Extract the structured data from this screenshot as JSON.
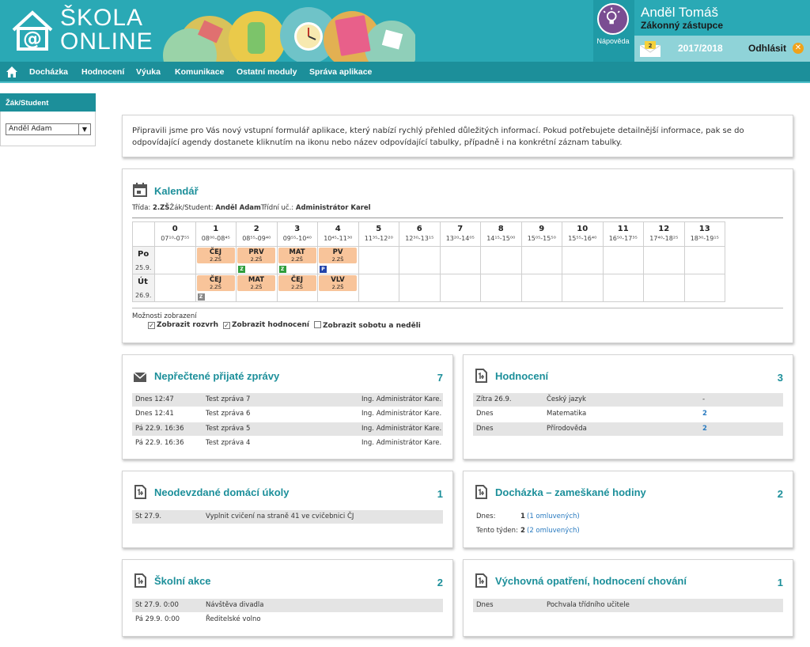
{
  "app": {
    "logo_line1": "ŠKOLA",
    "logo_line2": "ONLINE"
  },
  "user": {
    "help_label": "Nápověda",
    "name": "Anděl Tomáš",
    "role": "Zákonný zástupce",
    "messages_badge": "2",
    "school_year": "2017/2018",
    "logout_label": "Odhlásit"
  },
  "nav": {
    "items": [
      "Docházka",
      "Hodnocení",
      "Výuka",
      "Komunikace",
      "Ostatní moduly",
      "Správa aplikace"
    ]
  },
  "sidebar": {
    "header": "Žák/Student",
    "selected_student": "Anděl Adam"
  },
  "intro": {
    "text": "Připravili jsme pro Vás nový vstupní formulář aplikace, který nabízí rychlý přehled důležitých informací. Pokud potřebujete detailnější informace, pak se do odpovídající agendy dostanete kliknutím na ikonu nebo název odpovídající tabulky, případně i na konkrétní záznam tabulky."
  },
  "calendar": {
    "title": "Kalendář",
    "meta_class_label": "Třída: ",
    "meta_class": "2.ZŠ",
    "meta_student_label": "Žák/Student: ",
    "meta_student": "Anděl Adam",
    "meta_teacher_label": "Třídní uč.: ",
    "meta_teacher": "Administrátor Karel",
    "hours": [
      {
        "n": "0",
        "t": "07¹⁰-07⁵⁵"
      },
      {
        "n": "1",
        "t": "08⁰⁰-08⁴⁵"
      },
      {
        "n": "2",
        "t": "08⁵⁵-09⁴⁰"
      },
      {
        "n": "3",
        "t": "09⁵⁵-10⁴⁰"
      },
      {
        "n": "4",
        "t": "10⁴⁵-11³⁰"
      },
      {
        "n": "5",
        "t": "11³⁵-12²⁰"
      },
      {
        "n": "6",
        "t": "12³⁰-13¹⁵"
      },
      {
        "n": "7",
        "t": "13²⁰-14⁰⁵"
      },
      {
        "n": "8",
        "t": "14¹⁵-15⁰⁰"
      },
      {
        "n": "9",
        "t": "15⁰⁵-15⁵⁰"
      },
      {
        "n": "10",
        "t": "15⁵⁵-16⁴⁰"
      },
      {
        "n": "11",
        "t": "16⁵⁰-17³⁵"
      },
      {
        "n": "12",
        "t": "17⁴⁰-18²⁵"
      },
      {
        "n": "13",
        "t": "18³⁰-19¹⁵"
      }
    ],
    "days": [
      {
        "name": "Po",
        "date": "25.9.",
        "lessons": [
          {
            "hour": 1,
            "subject": "ČEJ",
            "room": "2.ZŠ",
            "mark": ""
          },
          {
            "hour": 2,
            "subject": "PRV",
            "room": "2.ZŠ",
            "mark": "Z"
          },
          {
            "hour": 3,
            "subject": "MAT",
            "room": "2.ZŠ",
            "mark": "Z"
          },
          {
            "hour": 4,
            "subject": "PV",
            "room": "2.ZŠ",
            "mark": "P"
          }
        ]
      },
      {
        "name": "Út",
        "date": "26.9.",
        "lessons": [
          {
            "hour": 1,
            "subject": "ČEJ",
            "room": "2.ZŠ",
            "mark": "Z"
          },
          {
            "hour": 2,
            "subject": "MAT",
            "room": "2.ZŠ",
            "mark": ""
          },
          {
            "hour": 3,
            "subject": "ČEJ",
            "room": "2.ZŠ",
            "mark": ""
          },
          {
            "hour": 4,
            "subject": "VLV",
            "room": "2.ZŠ",
            "mark": ""
          }
        ]
      }
    ],
    "options_label": "Možnosti zobrazení",
    "options": [
      {
        "label": "Zobrazit rozvrh",
        "checked": true
      },
      {
        "label": "Zobrazit hodnocení",
        "checked": true
      },
      {
        "label": "Zobrazit sobotu a neděli",
        "checked": false
      }
    ]
  },
  "messages": {
    "title": "Nepřečtené přijaté zprávy",
    "count": "7",
    "rows": [
      {
        "date": "Dnes 12:47",
        "subject": "Test zpráva 7",
        "from": "Ing. Administrátor Kare..."
      },
      {
        "date": "Dnes 12:41",
        "subject": "Test zpráva 6",
        "from": "Ing. Administrátor Kare..."
      },
      {
        "date": "Pá 22.9. 16:36",
        "subject": "Test zpráva 5",
        "from": "Ing. Administrátor Kare..."
      },
      {
        "date": "Pá 22.9. 16:36",
        "subject": "Test zpráva 4",
        "from": "Ing. Administrátor Kare..."
      }
    ]
  },
  "grades": {
    "title": "Hodnocení",
    "count": "3",
    "rows": [
      {
        "date": "Zítra 26.9.",
        "subject": "Český jazyk",
        "value": "-"
      },
      {
        "date": "Dnes",
        "subject": "Matematika",
        "value": "2"
      },
      {
        "date": "Dnes",
        "subject": "Přírodověda",
        "value": "2"
      }
    ]
  },
  "homework": {
    "title": "Neodevzdané domácí úkoly",
    "count": "1",
    "rows": [
      {
        "date": "St 27.9.",
        "text": "Vyplnit cvičení na straně 41 ve cvičebnici ČJ"
      }
    ]
  },
  "attendance": {
    "title": "Docházka – zameškané hodiny",
    "count": "2",
    "rows": [
      {
        "label": "Dnes:",
        "value": "1",
        "excused": "(1 omluvených)"
      },
      {
        "label": "Tento týden:",
        "value": "2",
        "excused": "(2 omluvených)"
      }
    ]
  },
  "events": {
    "title": "Školní akce",
    "count": "2",
    "rows": [
      {
        "date": "St 27.9. 0:00",
        "text": "Návštěva divadla"
      },
      {
        "date": "Pá 29.9. 0:00",
        "text": "Ředitelské volno"
      }
    ]
  },
  "conduct": {
    "title": "Výchovná opatření, hodnocení chování",
    "count": "1",
    "rows": [
      {
        "date": "Dnes",
        "text": "Pochvala třídního učitele"
      }
    ]
  },
  "colors": {
    "primary": "#2aa9b5",
    "nav": "#1c8f9a",
    "lesson": "#f8c49a",
    "mark_green": "#2e9e3c",
    "mark_blue": "#2244aa",
    "mark_gray": "#888888"
  }
}
